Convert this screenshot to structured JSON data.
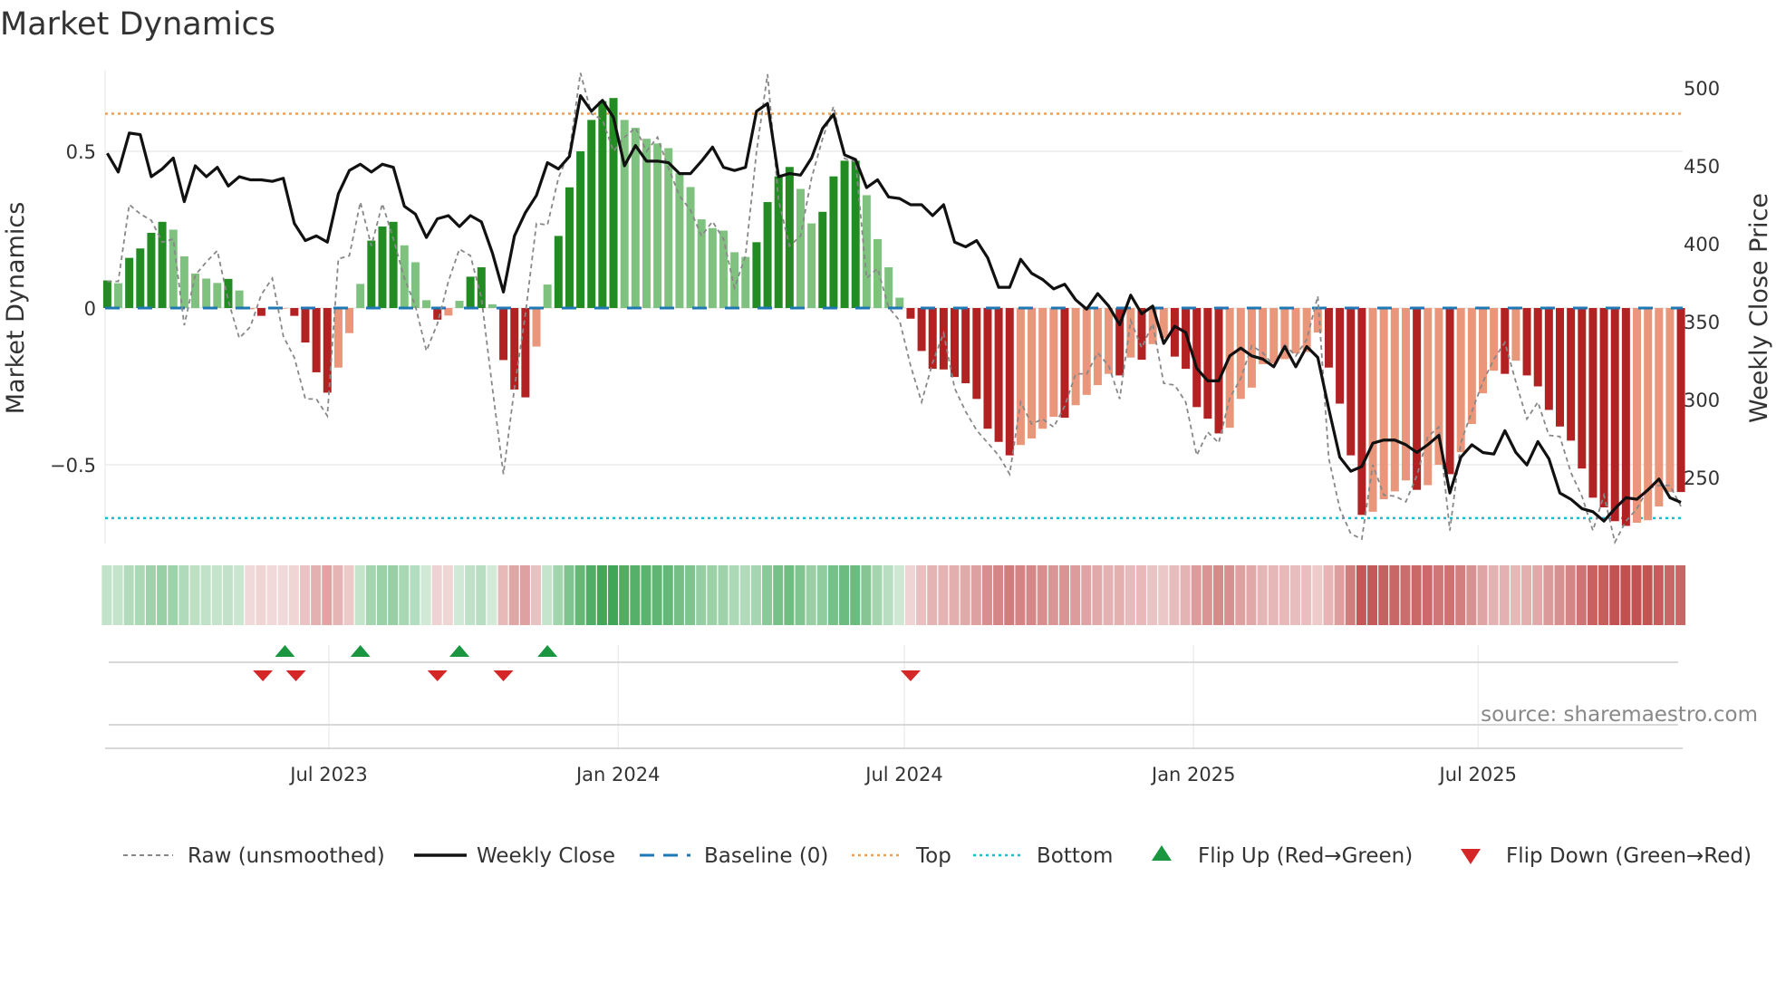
{
  "title": "Market Dynamics",
  "left_axis_label": "Market Dynamics",
  "right_axis_label": "Weekly Close Price",
  "source": "source: sharemaestro.com",
  "legend": {
    "raw": "Raw (unsmoothed)",
    "close": "Weekly Close",
    "baseline": "Baseline (0)",
    "top": "Top",
    "bottom": "Bottom",
    "flip_up": "Flip Up (Red→Green)",
    "flip_down": "Flip Down (Green→Red)"
  },
  "colors": {
    "green_strong": "#228b22",
    "green_weak": "#7fc27f",
    "red_strong": "#b22222",
    "red_weak": "#e9967a",
    "close": "#111111",
    "raw": "#888888",
    "baseline": "#1f77b4",
    "top": "#f0a050",
    "bottom": "#17becf",
    "flip_up": "#1a9641",
    "flip_down": "#d62728"
  },
  "chart_data": {
    "type": "bar",
    "title": "Market Dynamics",
    "ylabel": "Market Dynamics",
    "y2label": "Weekly Close Price",
    "ylim": [
      -0.75,
      0.76
    ],
    "y2lim": [
      208,
      501
    ],
    "yticks": [
      {
        "v": 0.5,
        "label": "0.5"
      },
      {
        "v": 0,
        "label": "0"
      },
      {
        "v": -0.5,
        "label": "−0.5"
      }
    ],
    "y2ticks": [
      {
        "v": 500,
        "label": "500"
      },
      {
        "v": 450,
        "label": "450"
      },
      {
        "v": 400,
        "label": "400"
      },
      {
        "v": 350,
        "label": "350"
      },
      {
        "v": 300,
        "label": "300"
      },
      {
        "v": 250,
        "label": "250"
      }
    ],
    "xticks": [
      {
        "date": "2023-07-01",
        "label": "Jul 2023"
      },
      {
        "date": "2024-01-01",
        "label": "Jan 2024"
      },
      {
        "date": "2024-07-01",
        "label": "Jul 2024"
      },
      {
        "date": "2025-01-01",
        "label": "Jan 2025"
      },
      {
        "date": "2025-07-01",
        "label": "Jul 2025"
      }
    ],
    "start_date": "2023-02-10",
    "frequency": "weekly",
    "top": 0.62,
    "bottom": -0.67,
    "baseline": 0,
    "bars": [
      0.088,
      0.079,
      0.16,
      0.19,
      0.24,
      0.275,
      0.25,
      0.165,
      0.11,
      0.094,
      0.08,
      0.093,
      0.056,
      -0.004,
      -0.025,
      -0.003,
      -0.002,
      -0.025,
      -0.11,
      -0.205,
      -0.27,
      -0.19,
      -0.08,
      0.077,
      0.215,
      0.26,
      0.275,
      0.2,
      0.146,
      0.025,
      -0.037,
      -0.024,
      0.023,
      0.1,
      0.13,
      0.012,
      -0.166,
      -0.26,
      -0.285,
      -0.123,
      0.075,
      0.23,
      0.385,
      0.5,
      0.6,
      0.66,
      0.67,
      0.6,
      0.575,
      0.54,
      0.525,
      0.51,
      0.43,
      0.386,
      0.283,
      0.255,
      0.247,
      0.178,
      0.163,
      0.21,
      0.338,
      0.42,
      0.45,
      0.38,
      0.27,
      0.307,
      0.42,
      0.47,
      0.47,
      0.36,
      0.22,
      0.13,
      0.033,
      -0.034,
      -0.137,
      -0.194,
      -0.196,
      -0.22,
      -0.24,
      -0.29,
      -0.385,
      -0.427,
      -0.47,
      -0.437,
      -0.416,
      -0.385,
      -0.347,
      -0.35,
      -0.31,
      -0.277,
      -0.246,
      -0.21,
      -0.215,
      -0.158,
      -0.165,
      -0.115,
      -0.096,
      -0.155,
      -0.194,
      -0.316,
      -0.353,
      -0.4,
      -0.382,
      -0.29,
      -0.254,
      -0.179,
      -0.177,
      -0.163,
      -0.145,
      -0.14,
      -0.078,
      -0.19,
      -0.305,
      -0.47,
      -0.66,
      -0.65,
      -0.61,
      -0.585,
      -0.55,
      -0.58,
      -0.565,
      -0.5,
      -0.53,
      -0.46,
      -0.37,
      -0.272,
      -0.2,
      -0.21,
      -0.168,
      -0.215,
      -0.25,
      -0.325,
      -0.378,
      -0.423,
      -0.512,
      -0.605,
      -0.636,
      -0.68,
      -0.695,
      -0.685,
      -0.677,
      -0.633,
      -0.587,
      -0.587
    ],
    "raw": [
      0.085,
      0.085,
      0.33,
      0.3,
      0.28,
      0.21,
      0.22,
      -0.055,
      0.105,
      0.147,
      0.183,
      0.023,
      -0.096,
      -0.06,
      0.043,
      0.095,
      -0.09,
      -0.158,
      -0.29,
      -0.29,
      -0.344,
      0.157,
      0.167,
      0.338,
      0.198,
      0.333,
      0.22,
      0.095,
      0.007,
      -0.137,
      -0.05,
      0.085,
      0.188,
      0.167,
      0.033,
      -0.256,
      -0.53,
      -0.256,
      -0.019,
      0.27,
      0.265,
      0.415,
      0.5,
      0.75,
      0.62,
      0.6,
      0.5,
      0.545,
      0.575,
      0.5,
      0.545,
      0.446,
      0.358,
      0.312,
      0.23,
      0.276,
      0.22,
      0.064,
      0.167,
      0.5,
      0.746,
      0.343,
      0.198,
      0.23,
      0.415,
      0.54,
      0.643,
      0.477,
      0.467,
      0.095,
      0.126,
      0.002,
      -0.04,
      -0.184,
      -0.3,
      -0.174,
      -0.08,
      -0.256,
      -0.33,
      -0.39,
      -0.43,
      -0.47,
      -0.53,
      -0.3,
      -0.37,
      -0.354,
      -0.38,
      -0.313,
      -0.21,
      -0.21,
      -0.143,
      -0.184,
      -0.29,
      -0.04,
      -0.127,
      -0.05,
      -0.24,
      -0.246,
      -0.3,
      -0.47,
      -0.396,
      -0.43,
      -0.287,
      -0.225,
      -0.12,
      -0.143,
      -0.184,
      -0.117,
      -0.153,
      -0.1,
      0.038,
      -0.48,
      -0.64,
      -0.72,
      -0.737,
      -0.5,
      -0.597,
      -0.6,
      -0.618,
      -0.535,
      -0.41,
      -0.38,
      -0.71,
      -0.43,
      -0.33,
      -0.236,
      -0.163,
      -0.11,
      -0.236,
      -0.354,
      -0.3,
      -0.406,
      -0.41,
      -0.525,
      -0.6,
      -0.71,
      -0.597,
      -0.747,
      -0.68,
      -0.64,
      -0.576,
      -0.566,
      -0.566,
      -0.633
    ],
    "close": [
      458,
      446,
      471,
      470,
      443,
      448,
      455,
      427,
      450,
      443,
      449,
      437,
      443,
      441,
      441,
      440,
      442,
      413,
      402,
      405,
      401,
      432,
      447,
      451,
      446,
      451,
      449,
      424,
      419,
      404,
      416,
      418,
      411,
      418,
      414,
      394,
      369,
      405,
      420,
      431,
      452,
      448,
      456,
      495,
      485,
      492,
      481,
      450,
      463,
      453,
      453,
      452,
      445,
      445,
      453,
      462,
      449,
      447,
      449,
      485,
      490,
      443,
      445,
      444,
      455,
      474,
      483,
      457,
      454,
      436,
      441,
      430,
      429,
      425,
      425,
      418,
      425,
      401,
      398,
      402,
      391,
      372,
      372,
      390,
      381,
      377,
      371,
      374,
      364,
      358,
      368,
      360,
      348,
      367,
      355,
      360,
      336,
      347,
      343,
      320,
      312,
      312,
      328,
      333,
      328,
      326,
      321,
      334,
      321,
      334,
      327,
      294,
      263,
      254,
      257,
      272,
      274,
      274,
      271,
      266,
      271,
      277,
      240,
      263,
      271,
      266,
      265,
      280,
      266,
      258,
      273,
      262,
      240,
      236,
      230,
      228,
      222,
      230,
      237,
      236,
      242,
      249,
      237,
      234
    ],
    "flips": [
      {
        "type": "up",
        "date": "2023-06-03"
      },
      {
        "type": "up",
        "date": "2023-07-21"
      },
      {
        "type": "up",
        "date": "2023-09-22"
      },
      {
        "type": "up",
        "date": "2023-11-17"
      },
      {
        "type": "down",
        "date": "2023-05-20"
      },
      {
        "type": "down",
        "date": "2023-06-10"
      },
      {
        "type": "down",
        "date": "2023-09-08"
      },
      {
        "type": "down",
        "date": "2023-10-20"
      },
      {
        "type": "down",
        "date": "2024-07-05"
      }
    ]
  }
}
